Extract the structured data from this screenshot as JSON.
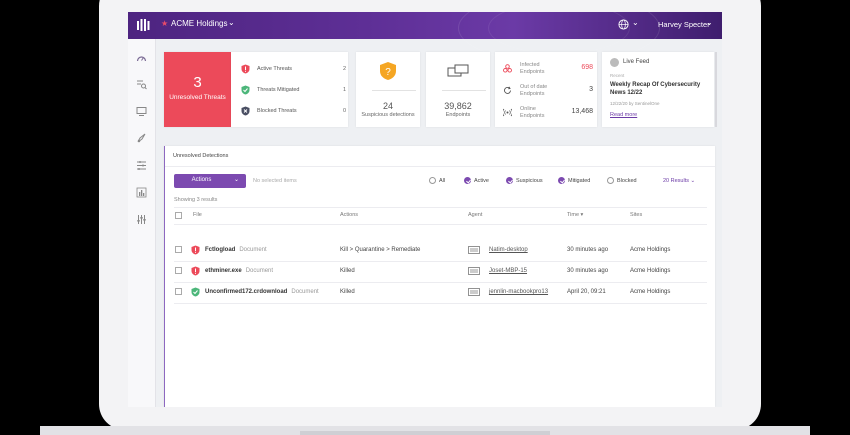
{
  "colors": {
    "accent": "#7c4ab0",
    "danger": "#ec4a5a",
    "success": "#4cb67a",
    "warning": "#f5a623",
    "topbar": "#5e2f96"
  },
  "header": {
    "org_name": "ACME Holdings",
    "user_name": "Harvey Specter"
  },
  "sidebar": {
    "icons": [
      "dashboard-icon",
      "search-list-icon",
      "monitor-icon",
      "rocket-icon",
      "filter-list-icon",
      "bar-chart-icon",
      "sliders-icon"
    ]
  },
  "summary": {
    "unresolved": {
      "count": "3",
      "label": "Unresolved Threats"
    },
    "threats": [
      {
        "label": "Active Threats",
        "value": "2",
        "icon": "red-shield-icon"
      },
      {
        "label": "Threats Mitigated",
        "value": "1",
        "icon": "green-shield-icon"
      },
      {
        "label": "Blocked Threats",
        "value": "0",
        "icon": "dark-shield-icon"
      }
    ],
    "suspicious": {
      "count": "24",
      "label": "Suspicious detections"
    },
    "endpoints": {
      "count": "39,862",
      "label": "Endpoints"
    },
    "endpoint_stats": [
      {
        "label_line1": "Infected",
        "label_line2": "Endpoints",
        "value": "698",
        "color": "#ec4a5a"
      },
      {
        "label_line1": "Out of date",
        "label_line2": "Endpoints",
        "value": "3",
        "color": "#444444"
      },
      {
        "label_line1": "Online",
        "label_line2": "Endpoints",
        "value": "13,468",
        "color": "#444444"
      }
    ],
    "live_feed": {
      "title": "Live Feed",
      "tag": "Recent",
      "headline_line1": "Weekly Recap Of Cybersecurity",
      "headline_line2": "News 12/22",
      "byline": "12/22/20 by SentinelOne",
      "link": "Read more"
    }
  },
  "detections": {
    "title": "Unresolved Detections",
    "actions_label": "Actions",
    "no_selection": "No selected items",
    "filters": [
      {
        "label": "All",
        "checked": false
      },
      {
        "label": "Active",
        "checked": true
      },
      {
        "label": "Suspicious",
        "checked": true
      },
      {
        "label": "Mitigated",
        "checked": true
      },
      {
        "label": "Blocked",
        "checked": false
      }
    ],
    "results_label": "20 Results",
    "showing": "Showing 3 results",
    "columns": {
      "file": "File",
      "actions": "Actions",
      "agent": "Agent",
      "time": "Time ▾",
      "sites": "Sites"
    },
    "rows": [
      {
        "file": "Fctlogload",
        "type": "Document",
        "actions": "Kill > Quarantine > Remediate",
        "agent": "Natim-desktop",
        "time": "30 minutes ago",
        "site": "Acme Holdings",
        "status": "active"
      },
      {
        "file": "ethminer.exe",
        "type": "Document",
        "actions": "Killed",
        "agent": "Joset-MBP-15",
        "time": "30 minutes ago",
        "site": "Acme Holdings",
        "status": "active"
      },
      {
        "file": "Unconfirmed172.crdownload",
        "type": "Document",
        "actions": "Killed",
        "agent": "jennlin-macbookpro13",
        "time": "April 20, 09:21",
        "site": "Acme Holdings",
        "status": "mitigated"
      }
    ]
  }
}
